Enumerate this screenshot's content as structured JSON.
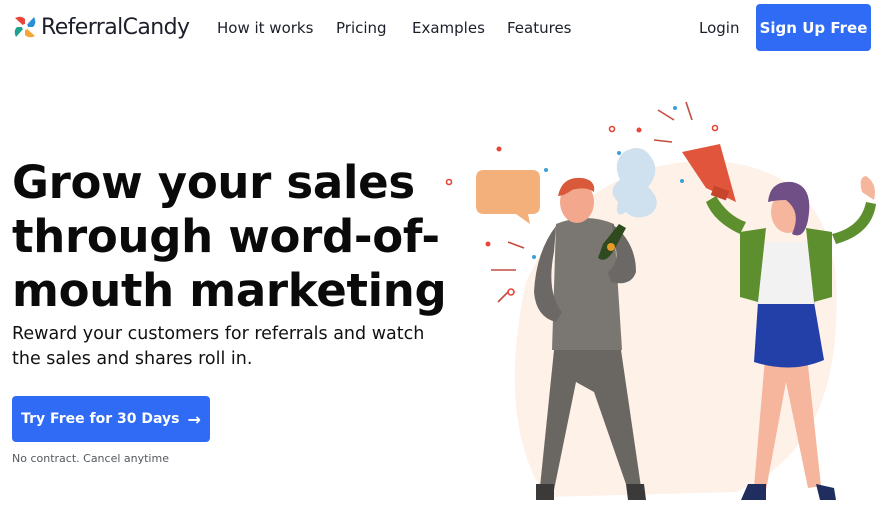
{
  "brand": {
    "name": "ReferralCandy",
    "logo_colors": [
      "#e8463a",
      "#2c8fd6",
      "#f4a638",
      "#1fa38f"
    ]
  },
  "nav": {
    "links": [
      {
        "label": "How it works"
      },
      {
        "label": "Pricing"
      },
      {
        "label": "Examples"
      },
      {
        "label": "Features"
      }
    ],
    "login_label": "Login",
    "signup_label": "Sign Up Free"
  },
  "hero": {
    "headline_lines": [
      "Grow your sales",
      "through word-of-",
      "mouth marketing"
    ],
    "subhead_lines": [
      "Reward your customers for referrals and watch",
      "the sales and shares roll in."
    ],
    "cta_label": "Try Free for 30 Days",
    "cta_icon": "arrow-right-icon",
    "fineprint": "No contract. Cancel anytime"
  },
  "colors": {
    "accent": "#2f6bf5",
    "background": "#ffffff"
  }
}
